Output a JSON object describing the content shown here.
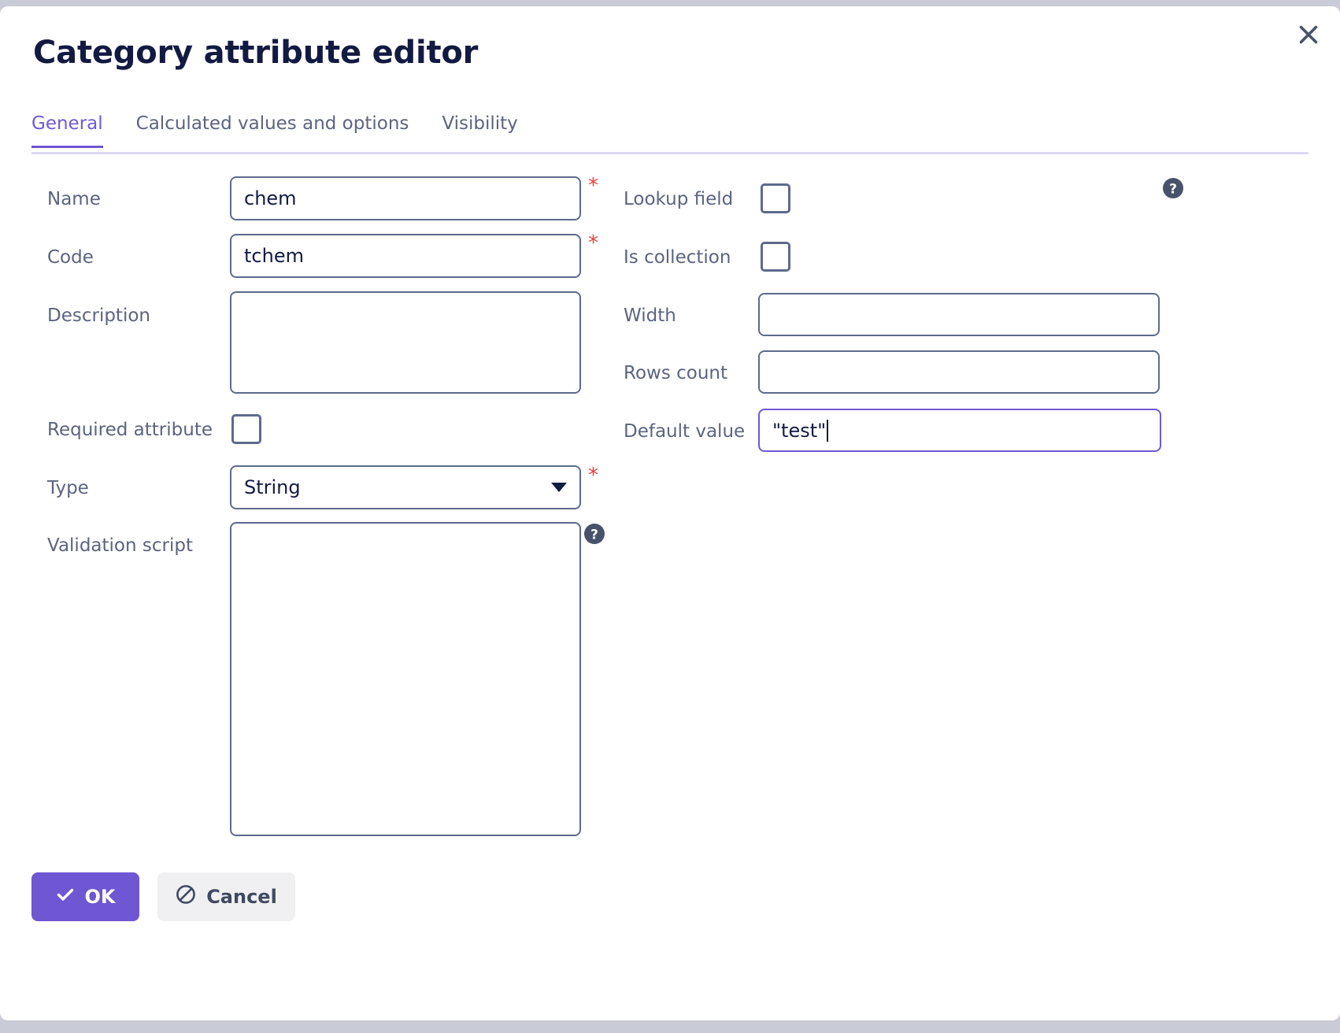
{
  "dialog": {
    "title": "Category attribute editor",
    "close_label": "×"
  },
  "tabs": [
    {
      "label": "General",
      "active": true
    },
    {
      "label": "Calculated values and options",
      "active": false
    },
    {
      "label": "Visibility",
      "active": false
    }
  ],
  "form": {
    "left": {
      "name": {
        "label": "Name",
        "value": "chem",
        "required_marker": "*"
      },
      "code": {
        "label": "Code",
        "value": "tchem",
        "required_marker": "*"
      },
      "description": {
        "label": "Description",
        "value": ""
      },
      "required_attribute": {
        "label": "Required attribute",
        "checked": false
      },
      "type": {
        "label": "Type",
        "value": "String",
        "required_marker": "*"
      },
      "validation_script": {
        "label": "Validation script",
        "value": ""
      }
    },
    "right": {
      "lookup_field": {
        "label": "Lookup field",
        "checked": false
      },
      "is_collection": {
        "label": "Is collection",
        "checked": false
      },
      "width": {
        "label": "Width",
        "value": ""
      },
      "rows_count": {
        "label": "Rows count",
        "value": ""
      },
      "default_value": {
        "label": "Default value",
        "value": "\"test\"",
        "focused": true
      }
    }
  },
  "footer": {
    "ok_label": "OK",
    "cancel_label": "Cancel"
  },
  "colors": {
    "accent": "#6f56d2",
    "title": "#131a42",
    "label": "#5b6480",
    "border": "#5d6a8c",
    "required": "#e8403a",
    "help_icon": "#48526b"
  }
}
